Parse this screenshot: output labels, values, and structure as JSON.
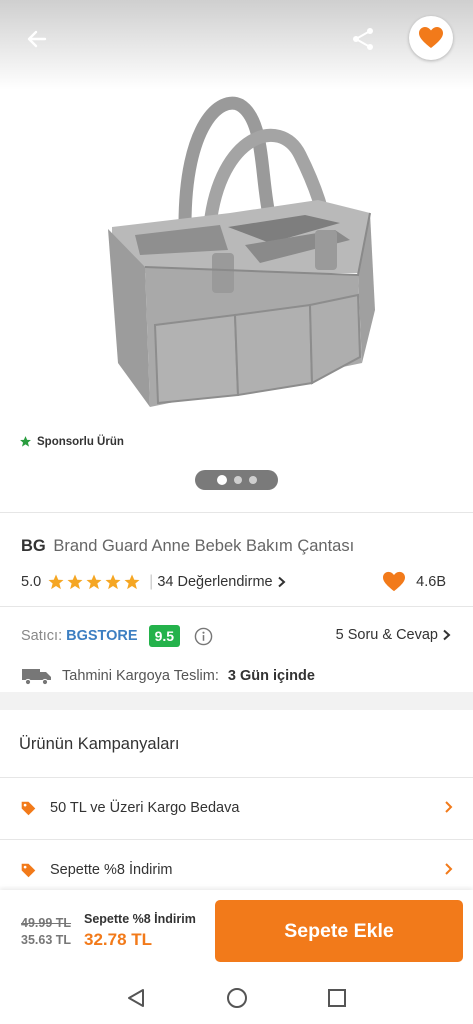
{
  "header": {
    "back_icon": "arrow-left-icon",
    "share_icon": "share-icon",
    "favorite_icon": "heart-icon"
  },
  "gallery": {
    "sponsored_label": "Sponsorlu Ürün",
    "image_count": 3,
    "active_index": 0
  },
  "product": {
    "brand": "BG",
    "name": "Brand Guard Anne Bebek Bakım Çantası",
    "rating": "5.0",
    "stars": 5,
    "reviews_label": "34 Değerlendirme",
    "likes": "4.6B"
  },
  "seller": {
    "label": "Satıcı:",
    "name": "BGSTORE",
    "score": "9.5",
    "qa_label": "5 Soru & Cevap"
  },
  "shipping": {
    "label": "Tahmini Kargoya Teslim:",
    "value": "3 Gün içinde"
  },
  "campaigns": {
    "title": "Ürünün Kampanyaları",
    "items": [
      {
        "label": "50 TL ve Üzeri Kargo Bedava"
      },
      {
        "label": "Sepette %8 İndirim"
      }
    ]
  },
  "bottom_bar": {
    "old_price": "49.99 TL",
    "cart_price": "35.63 TL",
    "discount_label": "Sepette %8 İndirim",
    "final_price": "32.78 TL",
    "add_button": "Sepete Ekle"
  },
  "colors": {
    "accent": "#f27a1a",
    "star": "#f5a623",
    "score_bg": "#24b24b",
    "seller_link": "#3d7fc2"
  }
}
